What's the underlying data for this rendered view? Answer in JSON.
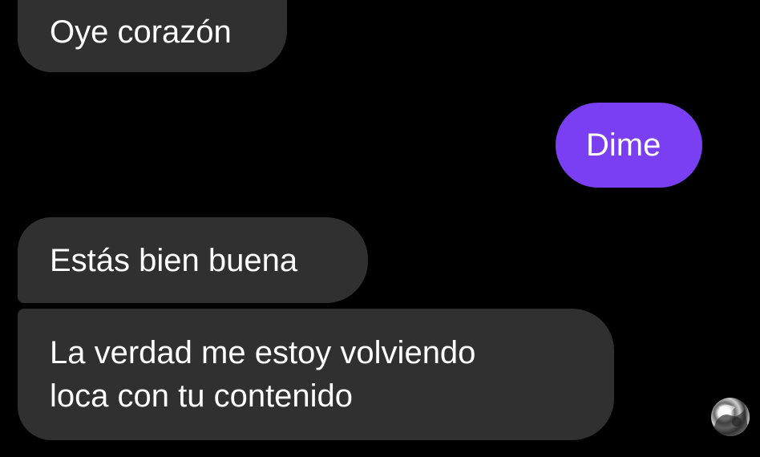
{
  "conversation": {
    "messages": [
      {
        "direction": "incoming",
        "lines": [
          "Oye corazón"
        ]
      },
      {
        "direction": "outgoing",
        "lines": [
          "Dime"
        ]
      },
      {
        "direction": "incoming",
        "lines": [
          "Estás bien buena"
        ]
      },
      {
        "direction": "incoming",
        "lines": [
          "La verdad me estoy volviendo",
          "loca con tu contenido"
        ]
      }
    ],
    "avatar_icon": "contact-avatar"
  },
  "colors": {
    "background": "#000000",
    "incoming_bubble": "#303030",
    "outgoing_bubble": "#7a3ff2",
    "text": "#ffffff"
  }
}
